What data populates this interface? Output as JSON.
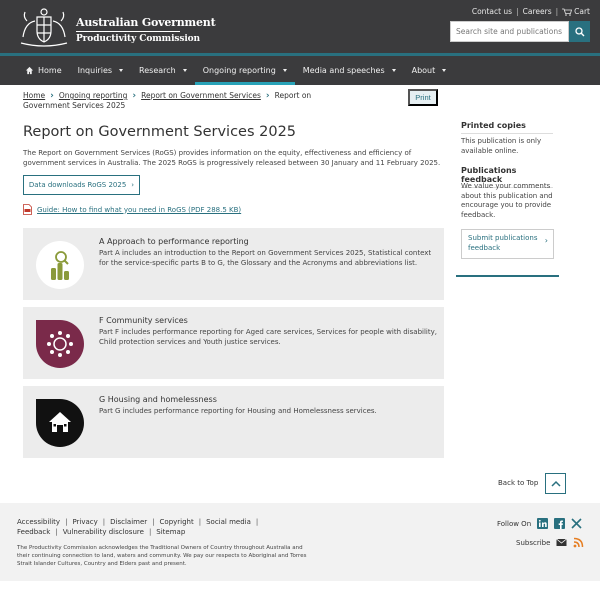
{
  "header": {
    "brand_line1": "Australian Government",
    "brand_line2": "Productivity Commission",
    "utility": {
      "contact": "Contact us",
      "careers": "Careers",
      "cart": "Cart"
    },
    "search_placeholder": "Search site and publications"
  },
  "nav": {
    "items": [
      {
        "label": "Home"
      },
      {
        "label": "Inquiries"
      },
      {
        "label": "Research"
      },
      {
        "label": "Ongoing reporting"
      },
      {
        "label": "Media and speeches"
      },
      {
        "label": "About"
      }
    ]
  },
  "breadcrumb": {
    "items": [
      "Home",
      "Ongoing reporting",
      "Report on Government Services",
      "Report on Government Services 2025"
    ]
  },
  "print_label": "Print",
  "main": {
    "title": "Report on Government Services 2025",
    "intro": "The Report on Government Services (RoGS) provides information on the equity, effectiveness and efficiency of government services in Australia. The 2025 RoGS is progressively released between 30 January and 11 February 2025.",
    "data_button": "Data downloads RoGS 2025",
    "guide_link": "Guide: How to find what you need in RoGS (PDF 288.5 KB)",
    "cards": [
      {
        "title": "A Approach to performance reporting",
        "desc": "Part A includes an introduction to the Report on Government Services 2025, Statistical context for the service-specific parts B to G, the Glossary and the Acronyms and abbreviations list.",
        "color": "#8a9a3a"
      },
      {
        "title": "F Community services",
        "desc": "Part F includes performance reporting for Aged care services, Services for people with disability, Child protection services and Youth justice services.",
        "color": "#7a2a4a"
      },
      {
        "title": "G Housing and homelessness",
        "desc": "Part G includes performance reporting for Housing and Homelessness services.",
        "color": "#111111"
      }
    ]
  },
  "sidebar": {
    "printed_heading": "Printed copies",
    "printed_text": "This publication is only available online.",
    "feedback_heading": "Publications feedback",
    "feedback_text": "We value your comments about this publication and encourage you to provide feedback.",
    "feedback_button": "Submit publications feedback"
  },
  "back_to_top": "Back to Top",
  "footer": {
    "links_row1": [
      "Accessibility",
      "Privacy",
      "Disclaimer",
      "Copyright",
      "Social media"
    ],
    "links_row2": [
      "Feedback",
      "Vulnerability disclosure",
      "Sitemap"
    ],
    "acknowledgement": "The Productivity Commission acknowledges the Traditional Owners of Country throughout Australia and their continuing connection to land, waters and community. We pay our respects to Aboriginal and Torres Strait Islander Cultures, Country and Elders past and present.",
    "follow_label": "Follow On",
    "subscribe_label": "Subscribe"
  },
  "colors": {
    "header_bg": "#3b3b3d",
    "accent": "#29707f",
    "card_bg": "#ececec",
    "footer_bg": "#f2f2f2"
  }
}
